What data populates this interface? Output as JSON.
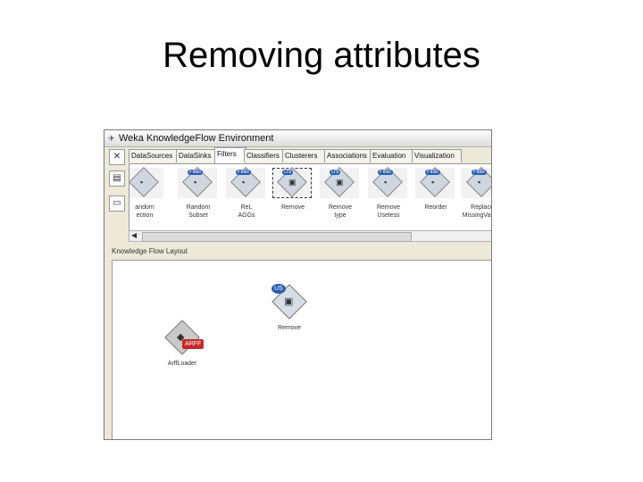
{
  "slide": {
    "title": "Removing attributes"
  },
  "window": {
    "title": "Weka KnowledgeFlow Environment"
  },
  "toolstrip": [
    {
      "name": "new-icon",
      "glyph": "✕"
    },
    {
      "name": "save-icon",
      "glyph": "▤"
    },
    {
      "name": "load-icon",
      "glyph": "▭"
    }
  ],
  "tabs": [
    {
      "label": "DataSources",
      "active": false
    },
    {
      "label": "DataSinks",
      "active": false
    },
    {
      "label": "Filters",
      "active": true
    },
    {
      "label": "Classifiers",
      "active": false
    },
    {
      "label": "Clusterers",
      "active": false
    },
    {
      "label": "Associations",
      "active": false
    },
    {
      "label": "Evaluation",
      "active": false
    },
    {
      "label": "Visualization",
      "active": false
    }
  ],
  "palette": [
    {
      "label": "andom\nection",
      "badge": ""
    },
    {
      "label": "Random\nSubset",
      "badge": "Filter"
    },
    {
      "label": "ReL\nAGGs",
      "badge": "Filter"
    },
    {
      "label": "Remove",
      "badge": "US",
      "selected": true
    },
    {
      "label": "Remove\ntype",
      "badge": "US"
    },
    {
      "label": "Remove\nUseless",
      "badge": "Filter"
    },
    {
      "label": "Reorder",
      "badge": "Filter"
    },
    {
      "label": "Replace\nMissingValues",
      "badge": "Filter"
    }
  ],
  "layout_label": "Knowledge Flow Layout",
  "canvas": {
    "nodes": [
      {
        "label": "Remove",
        "badge": "US",
        "glyph": "▣"
      },
      {
        "label": "ArffLoader",
        "badge": "ARFF",
        "glyph": "◆"
      }
    ]
  }
}
